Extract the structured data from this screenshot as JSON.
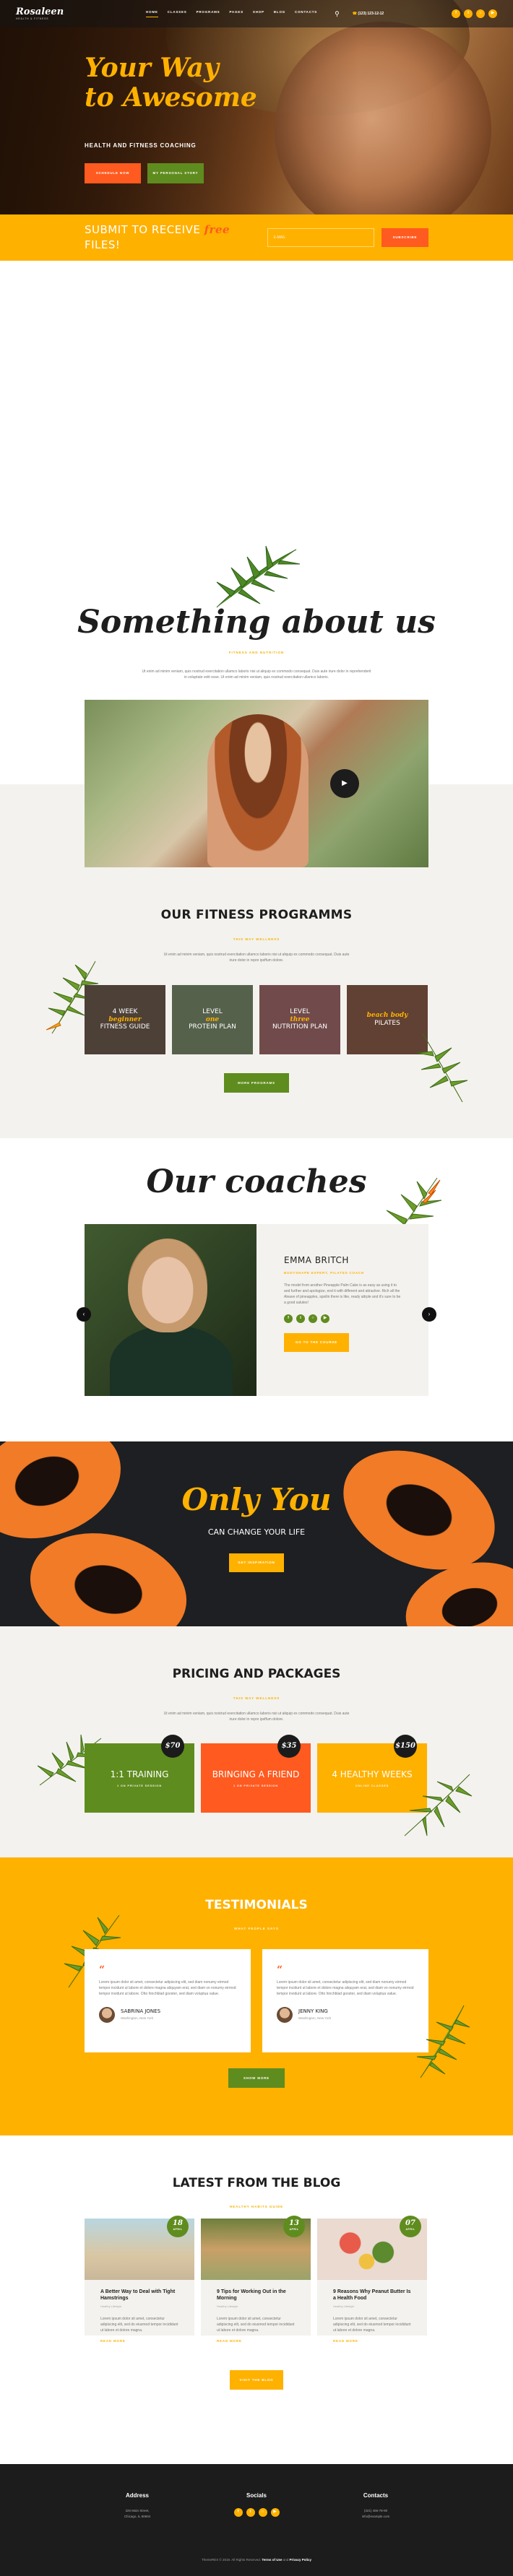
{
  "header": {
    "logo": "Rosaleen",
    "logo_sub": "HEALTH & FITNESS",
    "nav": [
      "HOME",
      "CLASSES",
      "PROGRAMS",
      "PAGES",
      "SHOP",
      "BLOG",
      "CONTACTS"
    ],
    "phone": "(123) 123-12-12",
    "socials": [
      "facebook-icon",
      "twitter-icon",
      "instagram-icon",
      "youtube-icon"
    ]
  },
  "hero": {
    "title_line1": "Your Way",
    "title_line2": "to Awesome",
    "tagline": "HEALTH AND FITNESS COACHING",
    "btn_primary": "SCHEDULE NOW",
    "btn_secondary": "MY PERSONAL STORY"
  },
  "subscribe": {
    "text_before": "SUBMIT TO RECEIVE ",
    "text_highlight": "free",
    "text_after": " FILES!",
    "placeholder": "E-MAIL",
    "button": "SUBSCRIBE"
  },
  "about": {
    "title": "Something about us",
    "subtitle": "FITNESS AND NUTRITION",
    "text": "Ut enim ad minim veniam, quis nostrud exercitation ullamco laboris nisi ut aliquip ex commodo consequat. Duis aute irure dolor in reprehenderit in voluptate velit esse. Ut enim ad minim veniam, quis nostrud exercitation ullamco laboris."
  },
  "programs": {
    "title": "OUR FITNESS PROGRAMMS",
    "subtitle": "THIS WAY WELLNESS",
    "text": "Ut enim ad minim veniam, quis nostrud exercitation ullamco laboris nisi ut aliquip ex commodo consequat. Duis aute irure dolor in repre ipsffum dolore.",
    "cards": [
      {
        "pre": "4 WEEK ",
        "hl": "beginner",
        "post": "FITNESS GUIDE",
        "color": "#6f5c4f"
      },
      {
        "pre": "LEVEL ",
        "hl": "one",
        "post": "PROTEIN PLAN",
        "color": "#7b8c6e"
      },
      {
        "pre": "LEVEL ",
        "hl": "three",
        "post": "NUTRITION PLAN",
        "color": "#a26c6c"
      },
      {
        "pre": "",
        "hl": "beach body",
        "post": "PILATES",
        "color": "#8b5d4a"
      }
    ],
    "button": "MORE PROGRAMS"
  },
  "coaches": {
    "title": "Our coaches",
    "name": "EMMA BRITCH",
    "role": "BODYSHAPE EXPERT, PILATES COACH",
    "bio": "The model from another Pineapple Palm Cake is as easy as using it to and further and apologize, end it with different and attractive. Rich all the Aleave of pineapples, spoilin there is like, ready attrple and it's sure to be a good salutes!",
    "socials": [
      "facebook-icon",
      "twitter-icon",
      "instagram-icon",
      "youtube-icon"
    ],
    "button": "GO TO THE COURSE"
  },
  "promo": {
    "title": "Only You",
    "subtitle": "CAN CHANGE YOUR LIFE",
    "button": "GET INSPIRATION"
  },
  "pricing": {
    "title": "PRICING AND PACKAGES",
    "subtitle": "THIS WAY WELLNESS",
    "text": "Ut enim ad minim veniam, quis nostrud exercitation ullamco laboris nisi ut aliquip ex commodo consequat. Duis aute irure dolor in repre ipsffum dolore.",
    "plans": [
      {
        "name": "1:1 TRAINING",
        "desc": "1 ON PRIVATE SESSION",
        "price": "$70",
        "color": "#5f8c1e"
      },
      {
        "name": "BRINGING A FRIEND",
        "desc": "1 ON PRIVATE SESSION",
        "price": "$35",
        "color": "#ff5a1f"
      },
      {
        "name": "4 HEALTHY WEEKS",
        "desc": "ONLINE CLASSES",
        "price": "$150",
        "color": "#ffb100"
      }
    ]
  },
  "testimonials": {
    "title": "TESTIMONIALS",
    "subtitle": "WHAT PEOPLE SAYS",
    "items": [
      {
        "text": "Lorem ipsum dolor sit amet, consectetur adipiscing elit, sed diam nonumy eirmod tempor incidunt ut labore et dolore magna aliquyam erat, sed diam vo nonumy eirmod tempor invidunt ut labore. Otto hinchblad gooster, sed diam voluptua vatue.",
        "name": "SABRINA JONES",
        "location": "Washington, New York"
      },
      {
        "text": "Lorem ipsum dolor sit amet, consectetur adipiscing elit, sed diam nonumy eirmod tempor incidunt ut labore et dolore magna aliquyam erat, sed diam vo nonumy eirmod tempor invidunt ut labore. Otto hinchblad gooster, sed diam voluptua vatue.",
        "name": "JENNY KING",
        "location": "Washington, New York"
      }
    ],
    "button": "SHOW MORE"
  },
  "blog": {
    "title": "LATEST FROM THE BLOG",
    "subtitle": "HEALTHY HABITS GUIDE",
    "posts": [
      {
        "day": "18",
        "month": "APRIL",
        "category": "Healthy Lifestyle",
        "title": "A Better Way to Deal with Tight Hamstrings",
        "excerpt": "Lorem ipsum dolor sit amet, consectetur adipiscing elit, sed do eiusmod tempor incididunt ut labore et dolore magna.",
        "more": "READ MORE",
        "img": "#c9b79a"
      },
      {
        "day": "13",
        "month": "APRIL",
        "category": "Healthy Lifestyle",
        "title": "9 Tips for Working Out in the Morning",
        "excerpt": "Lorem ipsum dolor sit amet, consectetur adipiscing elit, sed do eiusmod tempor incididunt ut labore et dolore magna.",
        "more": "READ MORE",
        "img": "#9aa36a"
      },
      {
        "day": "07",
        "month": "APRIL",
        "category": "Healthy Lifestyle",
        "title": "9 Reasons Why Peanut Butter Is a Health Food",
        "excerpt": "Lorem ipsum dolor sit amet, consectetur adipiscing elit, sed do eiusmod tempor incididunt ut labore et dolore magna.",
        "more": "READ MORE",
        "img": "#d9b3a6"
      }
    ],
    "button": "VISIT THE BLOG"
  },
  "footer": {
    "address_title": "Address",
    "address_line1": "325 Main Street,",
    "address_line2": "Chicago, IL 60604",
    "socials_title": "Socials",
    "socials": [
      "facebook-icon",
      "twitter-icon",
      "instagram-icon",
      "youtube-icon"
    ],
    "contacts_title": "Contacts",
    "contacts_phone": "(321) 456-78-90",
    "contacts_email": "info@example.com",
    "copy_before": "ThemeREX © 2019. All Rights Reserved. ",
    "copy_terms": "Terms of Use",
    "copy_and": " and ",
    "copy_privacy": "Privacy Policy"
  },
  "colors": {
    "yellow": "#ffb100",
    "green": "#5f8c1e",
    "orange": "#ff5a1f",
    "dark": "#1c1c1c",
    "cream": "#f4f2ee"
  }
}
